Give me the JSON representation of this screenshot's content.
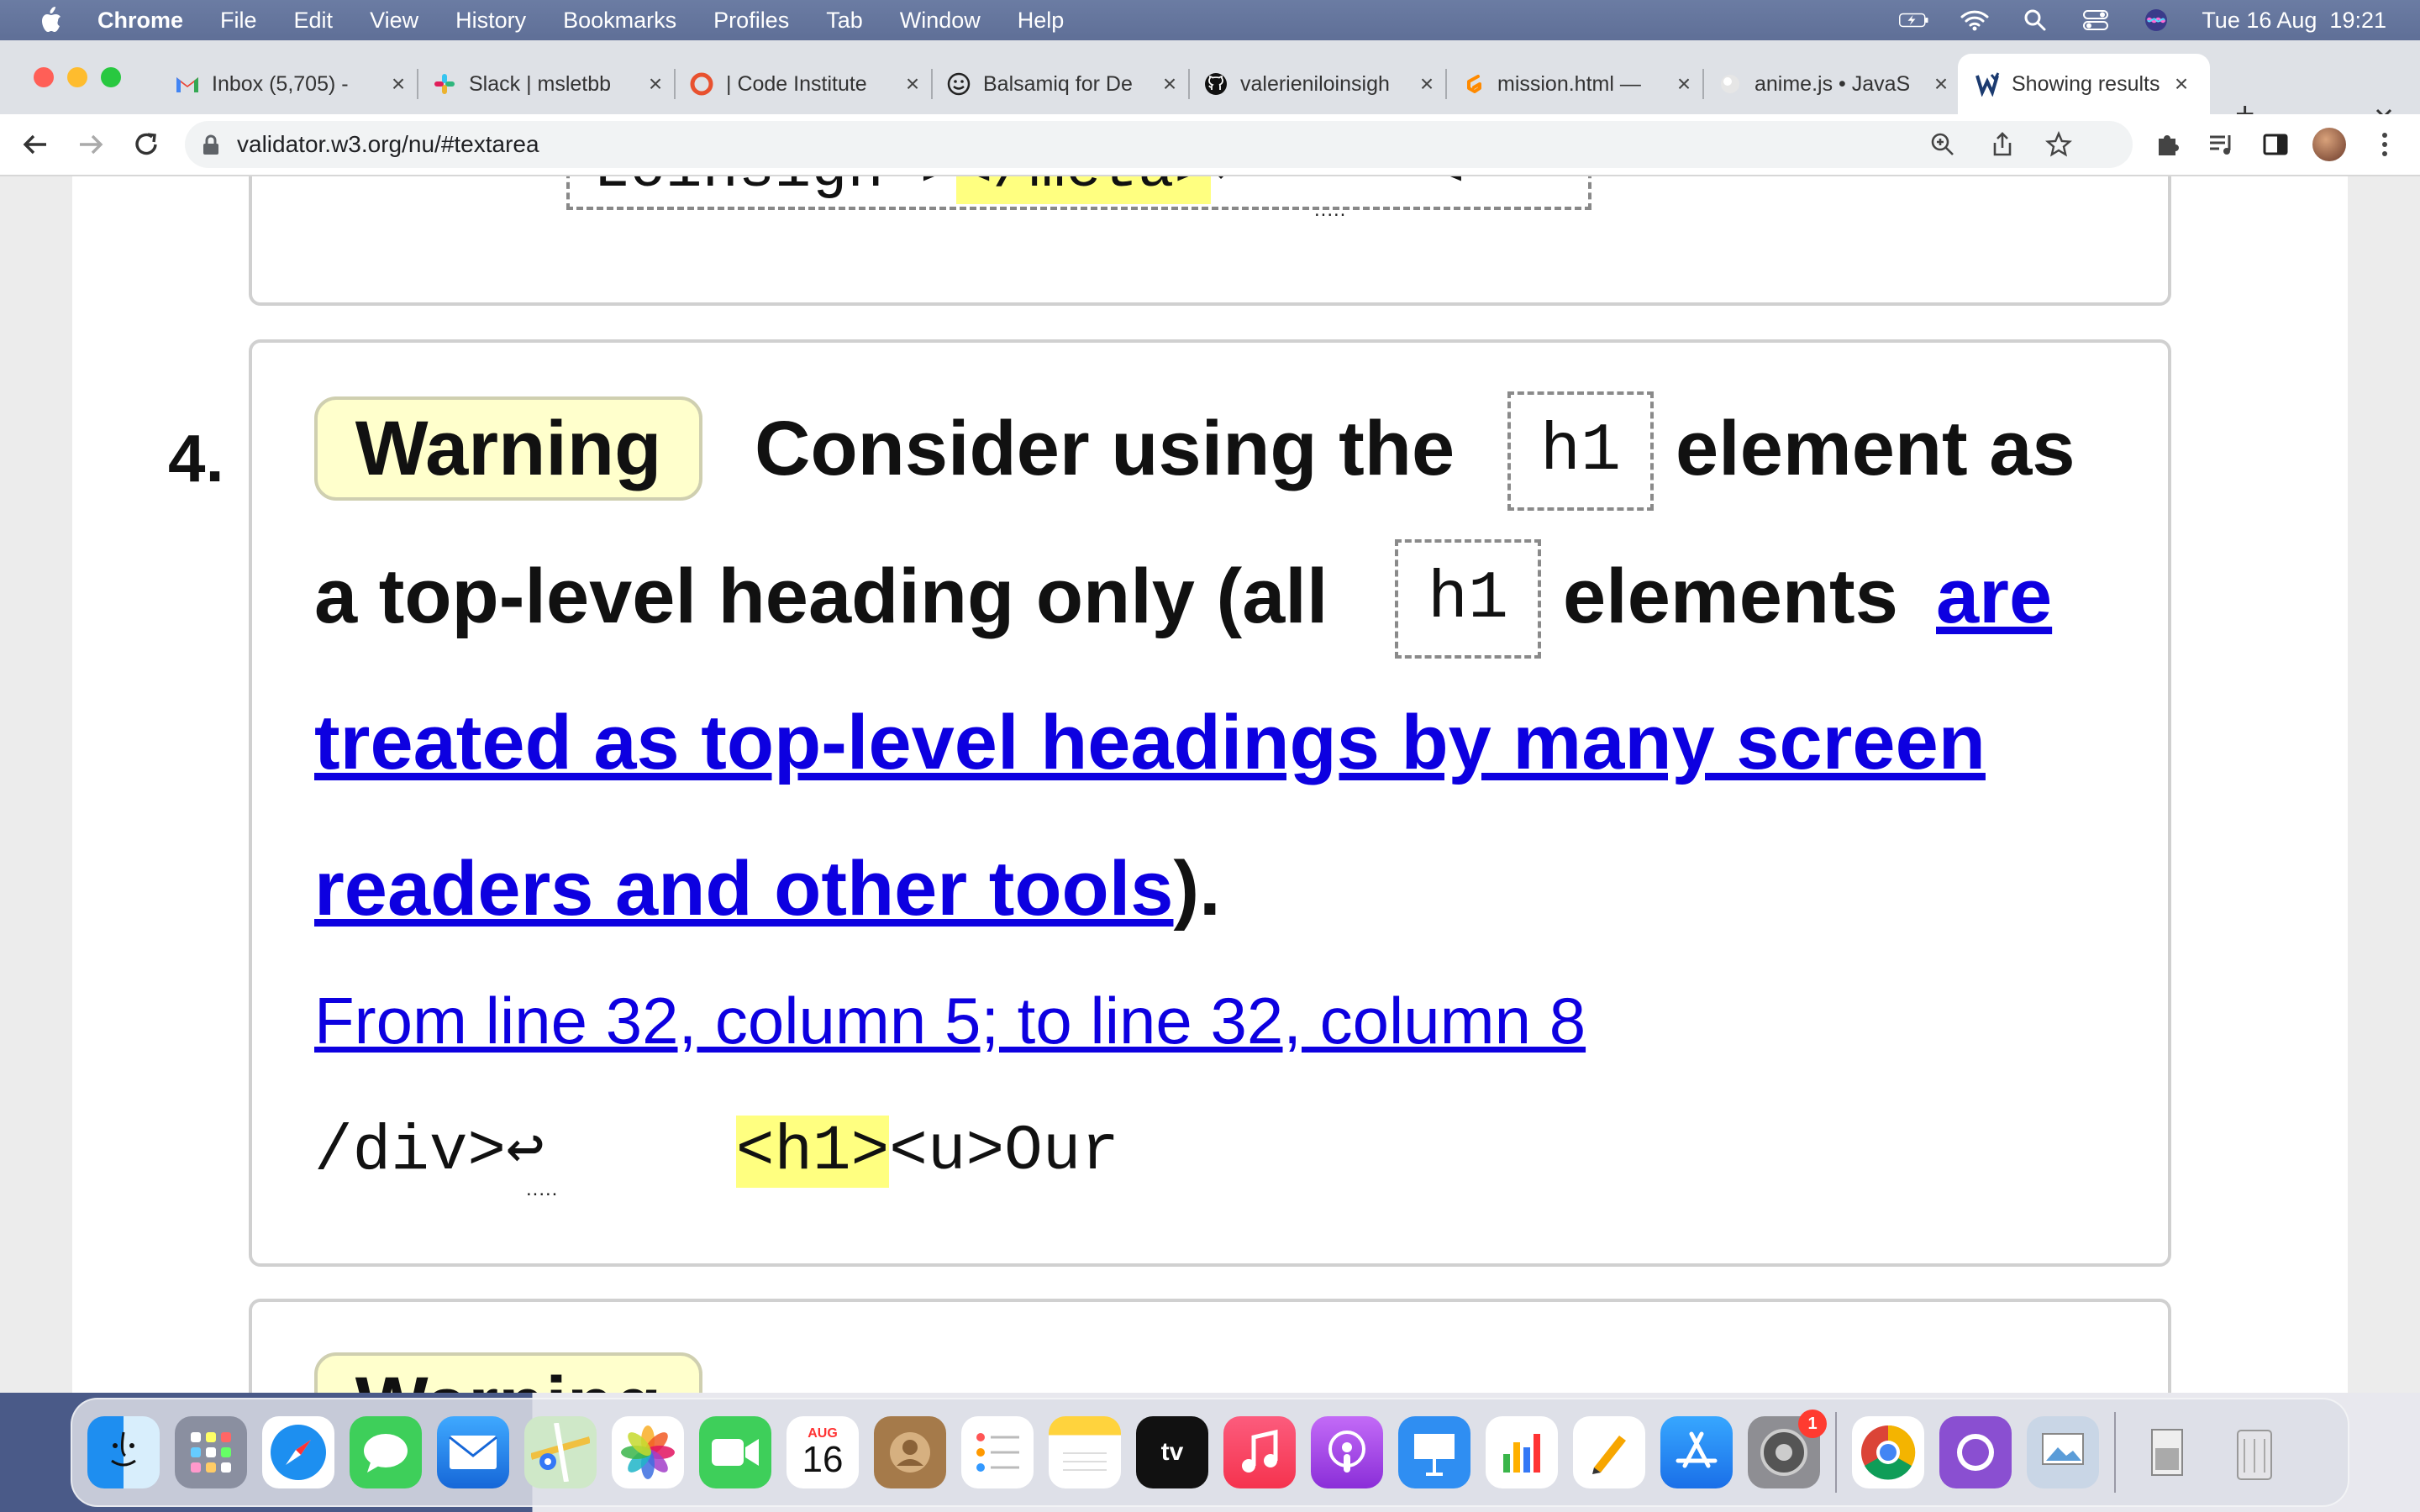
{
  "menubar": {
    "app_name": "Chrome",
    "items": [
      "File",
      "Edit",
      "View",
      "History",
      "Bookmarks",
      "Profiles",
      "Tab",
      "Window",
      "Help"
    ],
    "datetime": "Tue 16 Aug  19:21"
  },
  "tabs": [
    {
      "title": "Inbox (5,705) -",
      "icon": "gmail-icon"
    },
    {
      "title": "Slack | msletbb",
      "icon": "slack-icon"
    },
    {
      "title": "| Code Institute",
      "icon": "code-institute-icon"
    },
    {
      "title": "Balsamiq for De",
      "icon": "balsamiq-icon"
    },
    {
      "title": "valerieniloinsigh",
      "icon": "github-icon"
    },
    {
      "title": "mission.html —",
      "icon": "gitpod-icon"
    },
    {
      "title": "anime.js • JavaS",
      "icon": "anime-icon"
    },
    {
      "title": "Showing results",
      "icon": "validator-icon"
    }
  ],
  "address_bar": {
    "url": "validator.w3.org/nu/#textarea"
  },
  "content": {
    "prev_code": "Loinsigh\">",
    "prev_code_hl": "</meta>",
    "prev_code_tail": "↩     <",
    "item_number": "4.",
    "badge": "Warning",
    "msg_1": "Consider using the",
    "code_h1_a": "h1",
    "msg_2": "element as",
    "msg_3": "a top-level heading only (all",
    "code_h1_b": "h1",
    "msg_4": "elements",
    "link_1": "are",
    "link_2": "treated as top-level headings by many screen",
    "link_3": "readers and other tools",
    "msg_end": ").",
    "location": "From line 32, column 5; to line 32, column 8",
    "excerpt_pre": "/div>↩     ",
    "excerpt_hl": "<h1>",
    "excerpt_post": "<u>Our",
    "next_badge": "Warning"
  },
  "dock": {
    "calendar_month": "AUG",
    "calendar_day": "16",
    "settings_badge": "1",
    "tv_label": "tv"
  }
}
